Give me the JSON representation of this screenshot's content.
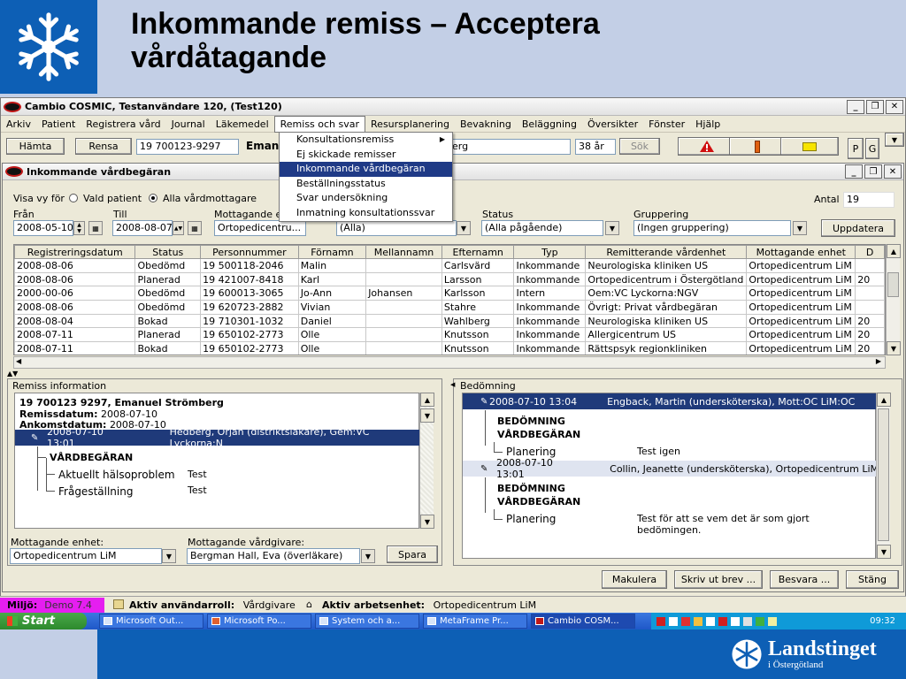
{
  "slide": {
    "title_line1": "Inkommande remiss – Acceptera",
    "title_line2": "vårdåtagande",
    "brand_name": "Landstinget",
    "brand_sub": "i Östergötland"
  },
  "app": {
    "title": "Cambio COSMIC, Testanvändare 120, (Test120)",
    "menu": [
      "Arkiv",
      "Patient",
      "Registrera vård",
      "Journal",
      "Läkemedel",
      "Remiss och svar",
      "Resursplanering",
      "Bevakning",
      "Beläggning",
      "Översikter",
      "Fönster",
      "Hjälp"
    ],
    "toolbar": {
      "fetch": "Hämta",
      "clear": "Rensa",
      "pnr": "19 700123-9297",
      "name_prefix": "Eman",
      "name_suffix": "erg",
      "age": "38 år",
      "search": "Sök",
      "p": "P",
      "g": "G"
    },
    "dropdown": [
      "Konsultationsremiss",
      "Ej skickade remisser",
      "Inkommande vårdbegäran",
      "Beställningsstatus",
      "Svar undersökning",
      "Inmatning konsultationssvar"
    ]
  },
  "inner": {
    "title": "Inkommande vårdbegäran",
    "filter": {
      "show_for": "Visa vy för",
      "opt_selected_patient": "Vald patient",
      "opt_all_receivers": "Alla vårdmottagare",
      "count_label": "Antal",
      "count_value": "19",
      "from_label": "Från",
      "from_value": "2008-05-10",
      "to_label": "Till",
      "to_value": "2008-08-07",
      "unit_label": "Mottagande e",
      "unit_value": "Ortopedicentru...",
      "col2_value": "(Alla)",
      "status_label": "Status",
      "status_value": "(Alla pågående)",
      "group_label": "Gruppering",
      "group_value": "(Ingen gruppering)",
      "update": "Uppdatera"
    },
    "table": {
      "headers": [
        "Registreringsdatum",
        "Status",
        "Personnummer",
        "Förnamn",
        "Mellannamn",
        "Efternamn",
        "Typ",
        "Remitterande vårdenhet",
        "Mottagande enhet",
        "D"
      ],
      "rows": [
        [
          "2008-08-06",
          "Obedömd",
          "19 500118-2046",
          "Malin",
          "",
          "Carlsvärd",
          "Inkommande",
          "Neurologiska kliniken US",
          "Ortopedicentrum LiM",
          ""
        ],
        [
          "2008-08-06",
          "Planerad",
          "19 421007-8418",
          "Karl",
          "",
          "Larsson",
          "Inkommande",
          "Ortopedicentrum i Östergötland",
          "Ortopedicentrum LiM",
          "20"
        ],
        [
          "2000-00-06",
          "Obedömd",
          "19 600013-3065",
          "Jo-Ann",
          "Johansen",
          "Karlsson",
          "Intern",
          "Oem:VC Lyckorna:NGV",
          "Ortopedicentrum LiM",
          ""
        ],
        [
          "2008-08-06",
          "Obedömd",
          "19 620723-2882",
          "Vivian",
          "",
          "Stahre",
          "Inkommande",
          "Övrigt: Privat vårdbegäran",
          "Ortopedicentrum LiM",
          ""
        ],
        [
          "2008-08-04",
          "Bokad",
          "19 710301-1032",
          "Daniel",
          "",
          "Wahlberg",
          "Inkommande",
          "Neurologiska kliniken US",
          "Ortopedicentrum LiM",
          "20"
        ],
        [
          "2008-07-11",
          "Planerad",
          "19 650102-2773",
          "Olle",
          "",
          "Knutsson",
          "Inkommande",
          "Allergicentrum US",
          "Ortopedicentrum LiM",
          "20"
        ],
        [
          "2008-07-11",
          "Bokad",
          "19 650102-2773",
          "Olle",
          "",
          "Knutsson",
          "Inkommande",
          "Rättspsyk regionkliniken",
          "Ortopedicentrum LiM",
          "20"
        ]
      ]
    },
    "remiss": {
      "title": "Remiss information",
      "line1": "19 700123 9297,  Emanuel  Strömberg",
      "line2_label": "Remissdatum:",
      "line2_value": "2008-07-10",
      "line3_label": "Ankomstdatum:",
      "line3_value": "2008-07-10",
      "entry_date": "2008-07-10  13:01",
      "entry_author": "Hedberg, Örjan (distriktsläkare), Gem:VC Lyckorna:N",
      "heading": "VÅRDBEGÄRAN",
      "item1_label": "Aktuellt hälsoproblem",
      "item1_value": "Test",
      "item2_label": "Frågeställning",
      "item2_value": "Test",
      "unit_label": "Mottagande enhet:",
      "unit_value": "Ortopedicentrum LiM",
      "caregiver_label": "Mottagande vårdgivare:",
      "caregiver_value": "Bergman Hall, Eva (överläkare)",
      "save": "Spara"
    },
    "assessment": {
      "title": "Bedömning",
      "entry1_date": "2008-07-10  13:04",
      "entry1_author": "Engback, Martin (undersköterska), Mott:OC LiM:OC",
      "heading1a": "BEDÖMNING",
      "heading1b": "VÅRDBEGÄRAN",
      "plan1_label": "Planering",
      "plan1_value": "Test igen",
      "entry2_date": "2008-07-10  13:01",
      "entry2_author": "Collin, Jeanette (undersköterska), Ortopedicentrum LiM",
      "heading2a": "BEDÖMNING",
      "heading2b": "VÅRDBEGÄRAN",
      "plan2_label": "Planering",
      "plan2_value_1": "Test för att se vem det är som gjort",
      "plan2_value_2": "bedömingen."
    },
    "buttons": {
      "cancel": "Makulera",
      "print": "Skriv ut brev ...",
      "reply": "Besvara ...",
      "close": "Stäng"
    }
  },
  "status": {
    "env_label": "Miljö:",
    "env_value": "Demo 7.4",
    "role_label": "Aktiv användarroll:",
    "role_value": "Vårdgivare",
    "unit_label": "Aktiv arbetsenhet:",
    "unit_value": "Ortopedicentrum LiM"
  },
  "taskbar": {
    "start": "Start",
    "tasks": [
      "Microsoft Out...",
      "Microsoft Po...",
      "System och a...",
      "MetaFrame Pr...",
      "Cambio COSM..."
    ],
    "clock": "09:32"
  },
  "colors": {
    "slide_bg": "#c3cfe6",
    "brand_blue": "#0d5fb5",
    "selected_row": "#1f3a7a",
    "window_face": "#ece9d8"
  }
}
